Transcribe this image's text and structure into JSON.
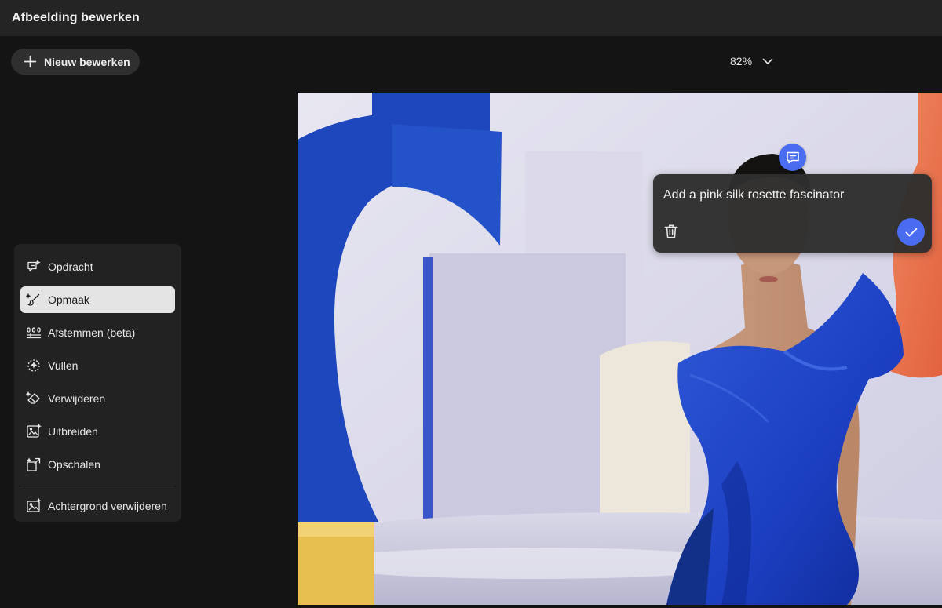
{
  "header": {
    "title": "Afbeelding bewerken"
  },
  "toolbar": {
    "new_edit_label": "Nieuw bewerken",
    "zoom_level": "82%"
  },
  "tools": [
    {
      "label": "Opdracht",
      "icon": "prompt-sparkle-icon",
      "active": false
    },
    {
      "label": "Opmaak",
      "icon": "brush-icon",
      "active": true
    },
    {
      "label": "Afstemmen (beta)",
      "icon": "adjust-sliders-icon",
      "active": false
    },
    {
      "label": "Vullen",
      "icon": "fill-icon",
      "active": false
    },
    {
      "label": "Verwijderen",
      "icon": "eraser-icon",
      "active": false
    },
    {
      "label": "Uitbreiden",
      "icon": "expand-icon",
      "active": false
    },
    {
      "label": "Opschalen",
      "icon": "upscale-icon",
      "active": false
    },
    {
      "label": "Achtergrond verwijderen",
      "icon": "remove-background-icon",
      "active": false
    }
  ],
  "prompt": {
    "text": "Add a pink silk rosette fascinator"
  },
  "colors": {
    "accent": "#4a6cf0",
    "active_tool_bg": "#e4e4e4",
    "panel_bg": "#222222"
  }
}
